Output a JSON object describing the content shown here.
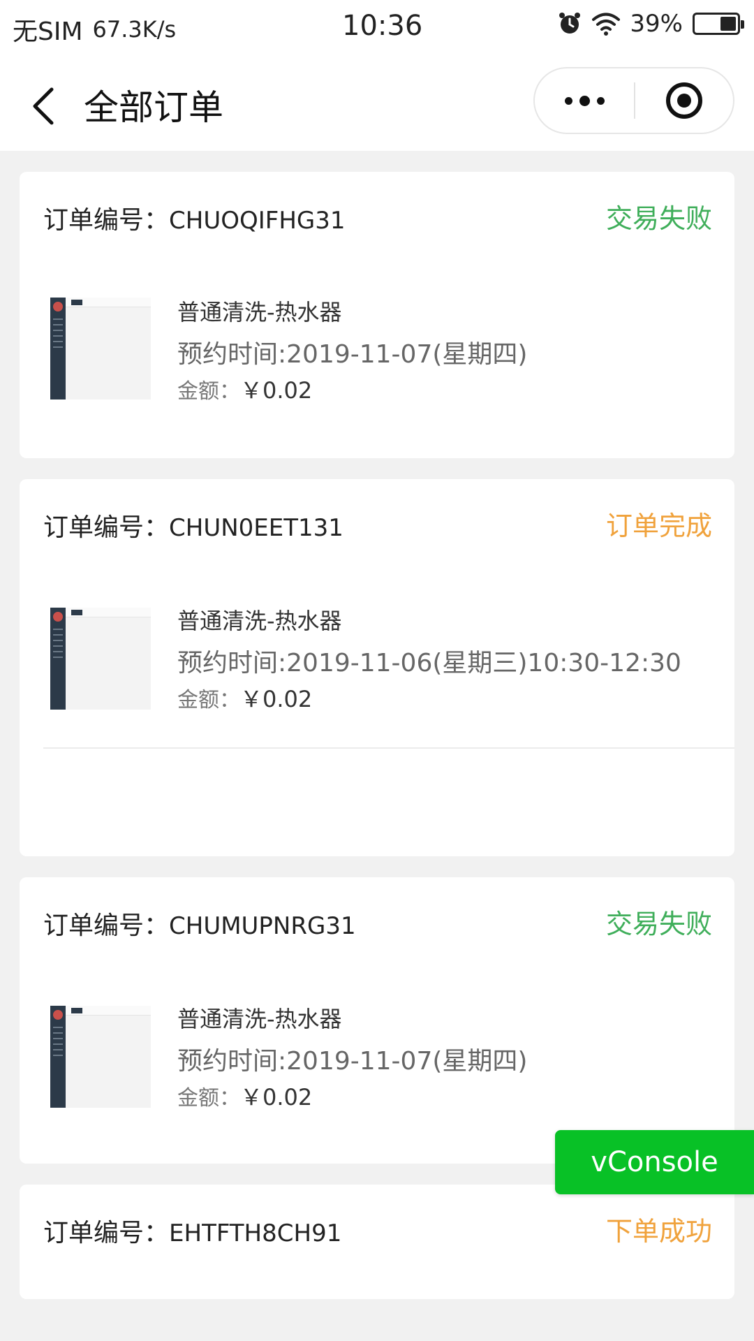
{
  "status_bar": {
    "carrier": "无SIM",
    "speed": "67.3K/s",
    "time": "10:36",
    "battery": "39%",
    "battery_level": 0.39
  },
  "nav": {
    "title": "全部订单"
  },
  "order_label": "订单编号：",
  "amount_label": "金额：",
  "orders": [
    {
      "id": "CHUOQIFHG31",
      "status": "交易失败",
      "service": "普通清洗-热水器",
      "appointment": "预约时间:2019-11-07(星期四)",
      "amount": "￥0.02"
    },
    {
      "id": "CHUN0EET131",
      "status": "订单完成",
      "service": "普通清洗-热水器",
      "appointment": "预约时间:2019-11-06(星期三)10:30-12:30",
      "amount": "￥0.02"
    },
    {
      "id": "CHUMUPNRG31",
      "status": "交易失败",
      "service": "普通清洗-热水器",
      "appointment": "预约时间:2019-11-07(星期四)",
      "amount": "￥0.02"
    },
    {
      "id": "EHTFTH8CH91",
      "status": "下单成功"
    }
  ],
  "vconsole": "vConsole",
  "colors": {
    "status_fail": "#3fae5a",
    "status_done": "#f0a23c",
    "vconsole": "#08c126"
  }
}
